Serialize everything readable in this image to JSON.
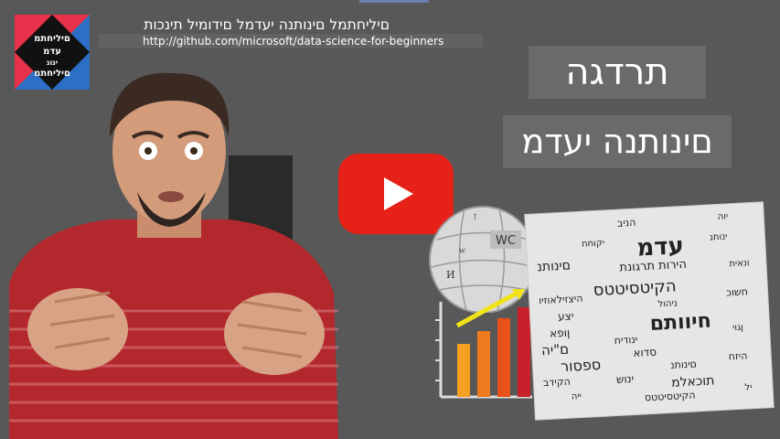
{
  "header": {
    "logo_lines": [
      "םיליחתמ",
      "עדמ",
      "ינונ",
      "םיליחתמ"
    ],
    "title": "םיליחתמל םינותנה יעדמל םידומיל תינכות",
    "url": "http://github.com/microsoft/data-science-for-beginners"
  },
  "headings": {
    "line1": "תרדגה",
    "line2": "םינותנה יעדמ"
  },
  "icons": {
    "play": "youtube-play-icon",
    "wiki": "wikipedia-globe-icon",
    "chart": "bar-chart-icon"
  },
  "globe_labels": [
    "WC",
    "ז",
    "ᵂ",
    "И"
  ],
  "word_cloud": [
    "עדמ",
    "הירות תרגונת",
    "חיוותם",
    "ינותנ",
    "םינותנ",
    "הקיטסיטטס",
    "היצזילאוזיו",
    "ניהול",
    "יצע",
    "ןופא",
    "הניב",
    "ם\"יה",
    "ינודיח",
    "סדוא",
    "ספסור",
    "םינותנ",
    "הקידב",
    "ינוש",
    "תוכאלמ",
    "ייה",
    "הקיטסיטטס",
    "ונאית",
    "חשוכ",
    "ןגוי",
    "היזח",
    "יקוחח",
    "יל",
    "יוה"
  ],
  "colors": {
    "background": "#585858",
    "youtube_red": "#e62117",
    "bar_colors": [
      "#f4a020",
      "#f07a1e",
      "#e8521a",
      "#c8202a"
    ],
    "arrow": "#f2e318"
  }
}
